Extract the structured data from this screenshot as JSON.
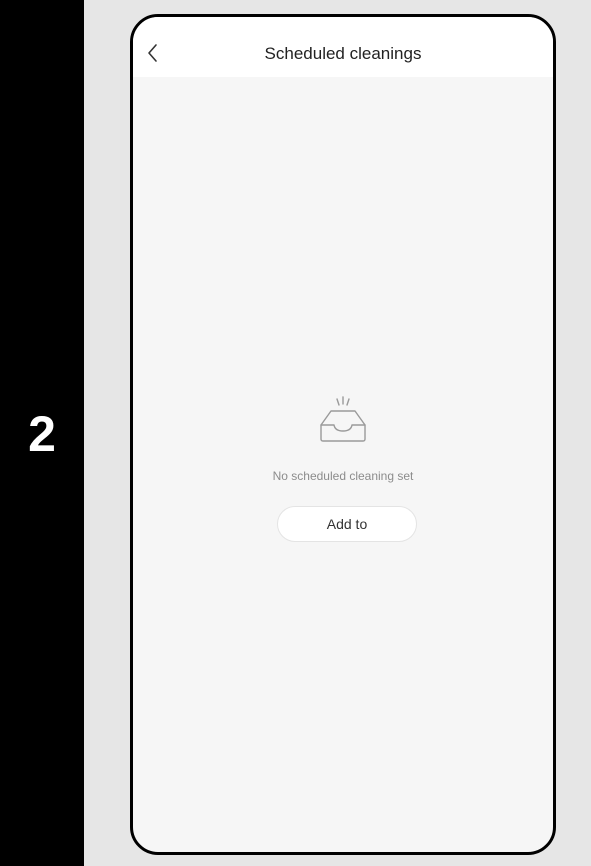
{
  "step": {
    "number": "2"
  },
  "header": {
    "title": "Scheduled cleanings",
    "back_icon": "chevron-left-icon"
  },
  "empty_state": {
    "icon": "empty-inbox-icon",
    "message": "No scheduled cleaning set",
    "button_label": "Add to"
  }
}
